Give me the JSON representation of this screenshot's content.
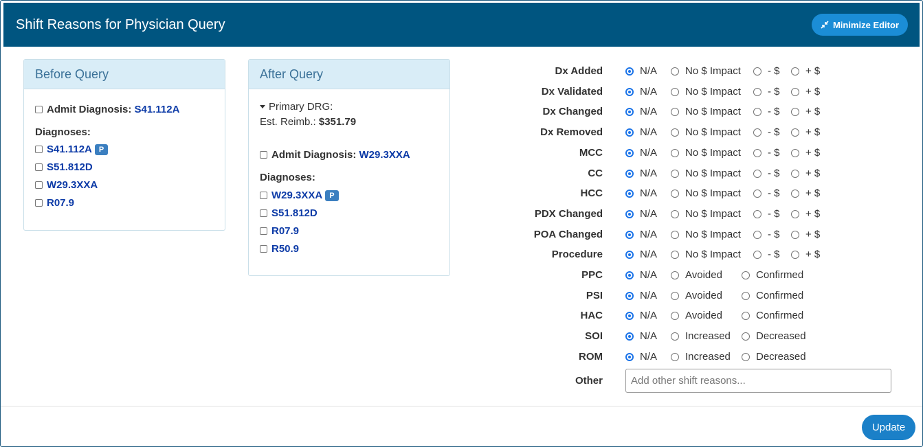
{
  "header": {
    "title": "Shift Reasons for Physician Query",
    "minimize_label": "Minimize Editor",
    "minimize_icon": "minimize-arrows-icon"
  },
  "before": {
    "title": "Before Query",
    "admit_label": "Admit Diagnosis:",
    "admit_code": "S41.112A",
    "diagnoses_label": "Diagnoses:",
    "diagnoses": [
      {
        "code": "S41.112A",
        "badge": "P"
      },
      {
        "code": "S51.812D",
        "badge": ""
      },
      {
        "code": "W29.3XXA",
        "badge": ""
      },
      {
        "code": "R07.9",
        "badge": ""
      }
    ]
  },
  "after": {
    "title": "After Query",
    "drg_label": "Primary DRG:",
    "reimb_label": "Est. Reimb.:",
    "reimb_value": "$351.79",
    "admit_label": "Admit Diagnosis:",
    "admit_code": "W29.3XXA",
    "diagnoses_label": "Diagnoses:",
    "diagnoses": [
      {
        "code": "W29.3XXA",
        "badge": "P"
      },
      {
        "code": "S51.812D",
        "badge": ""
      },
      {
        "code": "R07.9",
        "badge": ""
      },
      {
        "code": "R50.9",
        "badge": ""
      }
    ]
  },
  "reasons": [
    {
      "label": "Dx Added",
      "options": [
        "N/A",
        "No $ Impact",
        "- $",
        "+ $"
      ],
      "selected": 0
    },
    {
      "label": "Dx Validated",
      "options": [
        "N/A",
        "No $ Impact",
        "- $",
        "+ $"
      ],
      "selected": 0
    },
    {
      "label": "Dx Changed",
      "options": [
        "N/A",
        "No $ Impact",
        "- $",
        "+ $"
      ],
      "selected": 0
    },
    {
      "label": "Dx Removed",
      "options": [
        "N/A",
        "No $ Impact",
        "- $",
        "+ $"
      ],
      "selected": 0
    },
    {
      "label": "MCC",
      "options": [
        "N/A",
        "No $ Impact",
        "- $",
        "+ $"
      ],
      "selected": 0
    },
    {
      "label": "CC",
      "options": [
        "N/A",
        "No $ Impact",
        "- $",
        "+ $"
      ],
      "selected": 0
    },
    {
      "label": "HCC",
      "options": [
        "N/A",
        "No $ Impact",
        "- $",
        "+ $"
      ],
      "selected": 0
    },
    {
      "label": "PDX Changed",
      "options": [
        "N/A",
        "No $ Impact",
        "- $",
        "+ $"
      ],
      "selected": 0
    },
    {
      "label": "POA Changed",
      "options": [
        "N/A",
        "No $ Impact",
        "- $",
        "+ $"
      ],
      "selected": 0
    },
    {
      "label": "Procedure",
      "options": [
        "N/A",
        "No $ Impact",
        "- $",
        "+ $"
      ],
      "selected": 0
    },
    {
      "label": "PPC",
      "options": [
        "N/A",
        "Avoided",
        "Confirmed"
      ],
      "selected": 0
    },
    {
      "label": "PSI",
      "options": [
        "N/A",
        "Avoided",
        "Confirmed"
      ],
      "selected": 0
    },
    {
      "label": "HAC",
      "options": [
        "N/A",
        "Avoided",
        "Confirmed"
      ],
      "selected": 0
    },
    {
      "label": "SOI",
      "options": [
        "N/A",
        "Increased",
        "Decreased"
      ],
      "selected": 0
    },
    {
      "label": "ROM",
      "options": [
        "N/A",
        "Increased",
        "Decreased"
      ],
      "selected": 0
    }
  ],
  "other": {
    "label": "Other",
    "placeholder": "Add other shift reasons...",
    "value": ""
  },
  "footer": {
    "update_label": "Update"
  },
  "colors": {
    "header_bg": "#005580",
    "accent": "#1b8dd6",
    "code_text": "#0d3ba7",
    "radio_selected": "#1a73e8"
  }
}
